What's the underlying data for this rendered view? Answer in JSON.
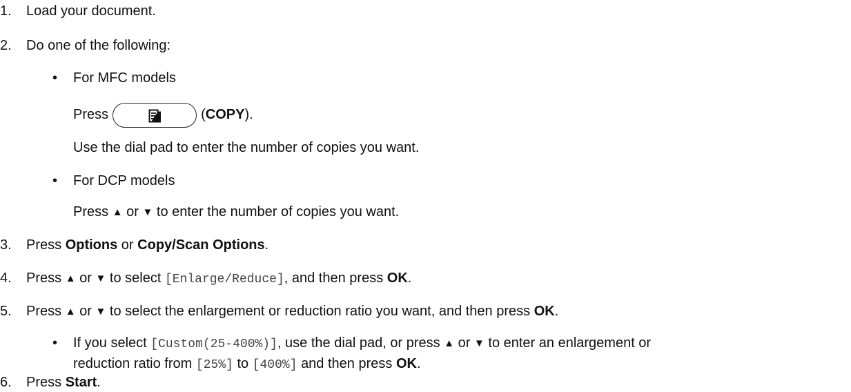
{
  "steps": [
    {
      "num": "1.",
      "text": "Load your document."
    },
    {
      "num": "2.",
      "text": "Do one of the following:"
    }
  ],
  "mfc": {
    "bullet": "•",
    "heading": "For MFC models",
    "press": "Press",
    "copy_label": "COPY",
    "paren_open": "(",
    "paren_close": ").",
    "copy_icon": "copy-document-icon",
    "dial_text": "Use the dial pad to enter the number of copies you want."
  },
  "dcp": {
    "bullet": "•",
    "heading": "For DCP models",
    "line_press": "Press",
    "up_arrow": "▲",
    "or": "or",
    "down_arrow": "▼",
    "line_rest": "to enter the number of copies you want."
  },
  "step3": {
    "num": "3.",
    "press": "Press",
    "options": "Options",
    "or": "or",
    "copy_scan": "Copy/Scan Options",
    "end": "."
  },
  "step4": {
    "num": "4.",
    "press": "Press",
    "up_arrow": "▲",
    "or": "or",
    "down_arrow": "▼",
    "to_select": "to select",
    "menu": "[Enlarge/Reduce]",
    "then": ", and then press",
    "ok": "OK",
    "end": "."
  },
  "step5": {
    "num": "5.",
    "press": "Press",
    "up_arrow": "▲",
    "or": "or",
    "down_arrow": "▼",
    "rest": "to select the enlargement or reduction ratio you want, and then press",
    "ok": "OK",
    "end": "."
  },
  "custom": {
    "bullet": "•",
    "if_select": "If you select",
    "custom_menu": "[Custom(25-400%)]",
    "use_dial": ", use the dial pad, or press",
    "up_arrow": "▲",
    "or": "or",
    "down_arrow": "▼",
    "enter_text": "to enter an enlargement or",
    "line2_a": "reduction ratio from",
    "min": "[25%]",
    "to": "to",
    "max": "[400%]",
    "line2_b": "and then press",
    "ok": "OK",
    "end": "."
  },
  "step6": {
    "num": "6.",
    "press": "Press",
    "start": "Start",
    "end": "."
  }
}
